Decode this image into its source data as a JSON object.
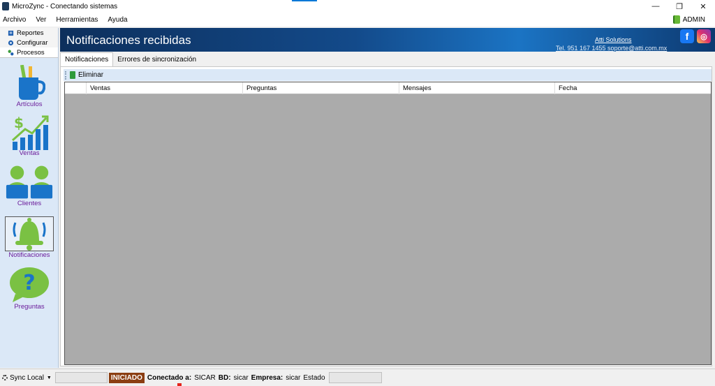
{
  "window": {
    "title": "MicroZync - Conectando sistemas",
    "minimize": "—",
    "restore": "❐",
    "close": "✕"
  },
  "menu": {
    "items": [
      "Archivo",
      "Ver",
      "Herramientas",
      "Ayuda"
    ],
    "user": "ADMIN"
  },
  "sidebar": {
    "tabs": [
      {
        "label": "Reportes",
        "icon": "report-icon"
      },
      {
        "label": "Configurar",
        "icon": "settings-icon"
      },
      {
        "label": "Procesos",
        "icon": "process-icon"
      }
    ],
    "active_tab": "Procesos",
    "modules": [
      {
        "label": "Artículos",
        "icon": "articles-icon"
      },
      {
        "label": "Ventas",
        "icon": "sales-chart-icon"
      },
      {
        "label": "Clientes",
        "icon": "customers-icon"
      },
      {
        "label": "Notificaciones",
        "icon": "bell-icon"
      },
      {
        "label": "Preguntas",
        "icon": "question-icon"
      }
    ],
    "selected_module": "Notificaciones"
  },
  "banner": {
    "title": "Notificaciones recibidas",
    "company": "Atti Solutions",
    "contact": "Tel. 951 167 1455  soporte@atti.com.mx",
    "social": [
      "facebook-icon",
      "instagram-icon"
    ]
  },
  "tabs": {
    "items": [
      "Notificaciones",
      "Errores de sincronización"
    ],
    "active": "Notificaciones"
  },
  "toolbar": {
    "delete_label": "Eliminar"
  },
  "grid": {
    "columns": [
      "Ventas",
      "Preguntas",
      "Mensajes",
      "Fecha"
    ],
    "rows": []
  },
  "status": {
    "sync_label": "Sync Local",
    "state": "INICIADO",
    "connected_label": "Conectado a:",
    "connected_value": "SICAR",
    "db_label": "BD:",
    "db_value": "sicar",
    "company_label": "Empresa:",
    "company_value": "sicar",
    "estado_label": "Estado"
  },
  "colors": {
    "banner_dark": "#0d2f5c",
    "banner_light": "#1b74c4",
    "module_label": "#6a1b9a",
    "status_badge": "#8b3e12",
    "tab_underline": "#e3241b",
    "grid_bg": "#ababab"
  }
}
